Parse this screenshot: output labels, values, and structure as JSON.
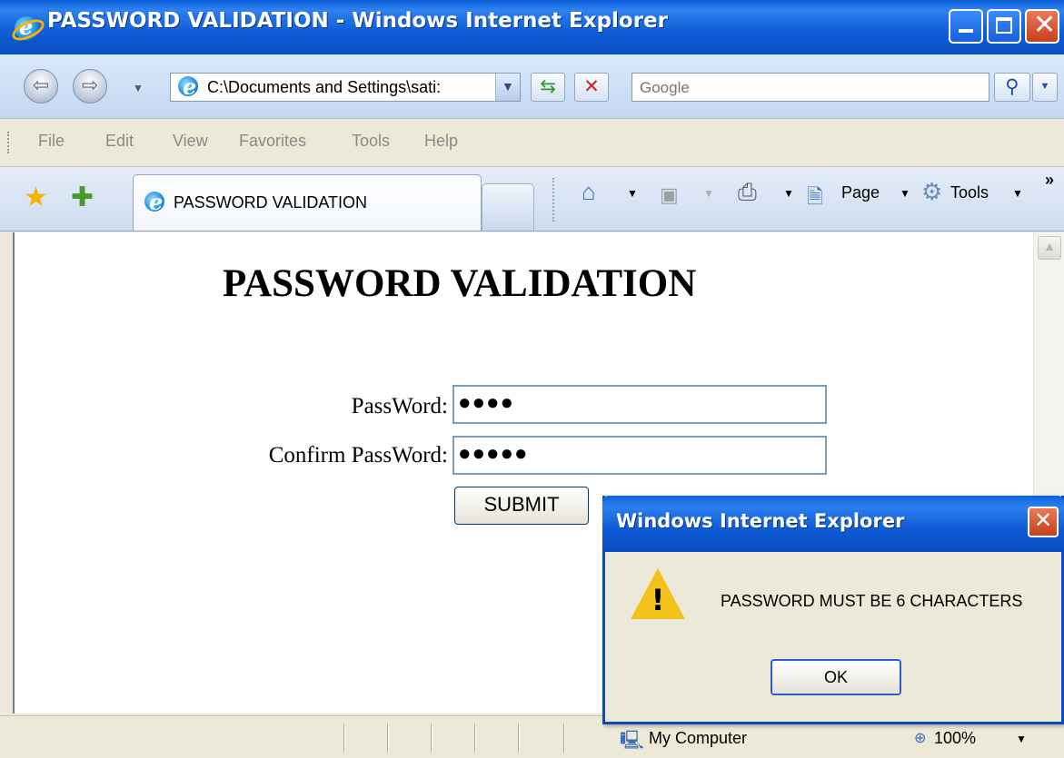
{
  "window": {
    "title": "PASSWORD VALIDATION - Windows Internet Explorer",
    "minimize_icon": "minimize-icon",
    "maximize_icon": "maximize-icon",
    "close_icon": "close-icon"
  },
  "address_bar": {
    "url": "C:\\Documents and Settings\\sati:",
    "search_placeholder": "Google"
  },
  "menu": {
    "items": [
      "File",
      "Edit",
      "View",
      "Favorites",
      "Tools",
      "Help"
    ]
  },
  "tab": {
    "label": "PASSWORD VALIDATION"
  },
  "command_bar": {
    "page_label": "Page",
    "tools_label": "Tools",
    "overflow": "»"
  },
  "page": {
    "title": "PASSWORD VALIDATION",
    "password_label": "PassWord:",
    "password_value": "●●●●",
    "confirm_label": "Confirm PassWord:",
    "confirm_value": "●●●●●",
    "submit_label": "SUBMIT"
  },
  "status_bar": {
    "zone": "My Computer",
    "zoom": "100%"
  },
  "dialog": {
    "title": "Windows Internet Explorer",
    "message": "PASSWORD MUST BE 6 CHARACTERS",
    "ok_label": "OK",
    "icon": "warning-icon"
  },
  "colors": {
    "titlebar_blue": "#0a5fd8",
    "close_red": "#c6401c",
    "warning_yellow": "#f2c21a"
  }
}
